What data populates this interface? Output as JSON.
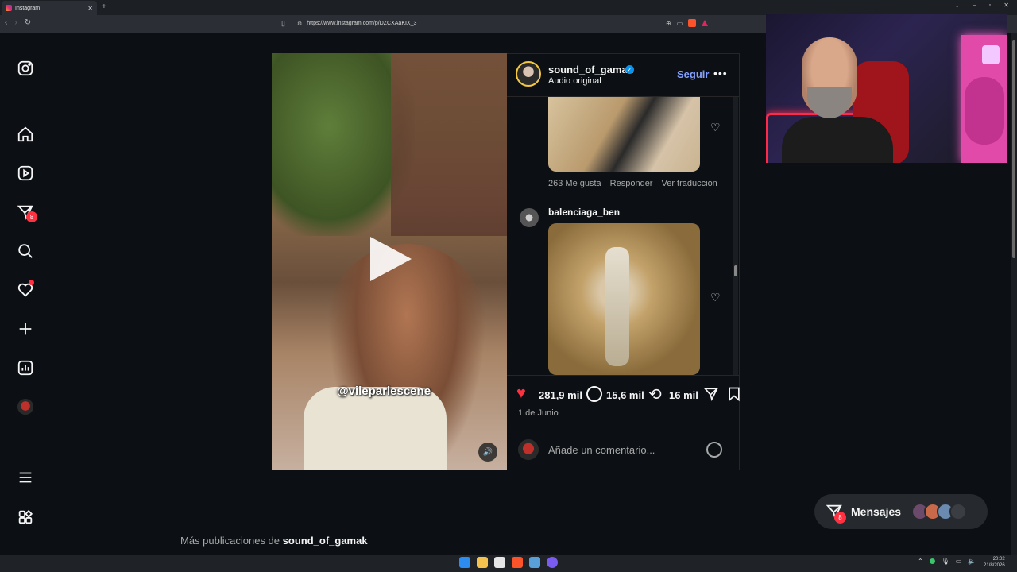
{
  "browser": {
    "tab_title": "Instagram",
    "tab_close": "✕",
    "new_tab": "+",
    "url": "https://www.instagram.com/p/DZCXAaKIX_3"
  },
  "sidebar": {
    "notifications_badge": "8"
  },
  "post": {
    "author": "sound_of_gamak",
    "audio": "Audio original",
    "follow_label": "Seguir",
    "more_label": "•••",
    "watermark": "@vileparlescene",
    "likes": "281,9 mil",
    "comments": "15,6 mil",
    "reposts": "16 mil",
    "date": "1 de Junio",
    "comment_placeholder": "Añade un comentario..."
  },
  "comments": [
    {
      "likes_text": "263 Me gusta",
      "reply_label": "Responder",
      "translate_label": "Ver traducción"
    },
    {
      "user": "balenciaga_ben"
    }
  ],
  "more_posts": {
    "prefix": "Más publicaciones de",
    "user": "sound_of_gamak"
  },
  "messages": {
    "label": "Mensajes",
    "badge": "8"
  },
  "taskbar": {
    "time": "20:02",
    "date": "21/8/2026"
  },
  "colors": {
    "accent_follow": "#85a1ff",
    "like": "#ff3040",
    "badge": "#ff3040",
    "verified": "#0095f6",
    "background": "#0c1014"
  }
}
